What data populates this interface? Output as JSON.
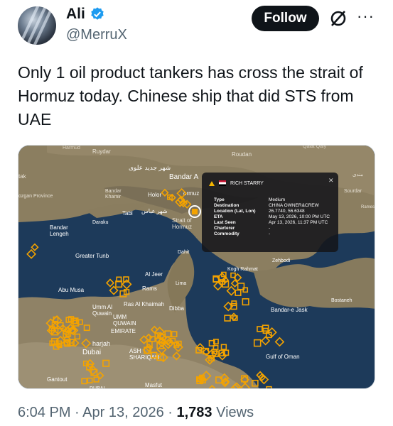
{
  "author": {
    "name": "Ali",
    "handle": "@MerruX",
    "verified": true
  },
  "actions": {
    "follow_label": "Follow",
    "grok_icon": "grok-icon",
    "more_icon": "more-icon",
    "more_glyph": "···"
  },
  "tweet": {
    "text": "Only 1 oil product tankers has cross the strait of Hormuz today. Chinese ship that did STS from UAE"
  },
  "map": {
    "place_labels": {
      "hormud": "Harmud",
      "ruydar": "Ruydar",
      "roudan": "Roudan",
      "qalat": "Qalat Qaly",
      "tak": "tak",
      "shahr_jadid": "شهر جديد علوی",
      "bandar_a": "Bandar A",
      "mandi": "مندی",
      "pezgan": "ozgan Province",
      "bandar_khamir": "Bandar\nKhamir",
      "holor": "Holor",
      "hormuz": "ormuz",
      "sourdar": "Sourdar",
      "rames": "Rames",
      "tabl": "Tabl",
      "shahr_abbas": "شهر عباس",
      "bandar_lengeh": "Bandar\nLengeh",
      "daraku": "Daraku",
      "strait": "Strait of\nHormuz",
      "greater_tunb": "Greater Tunb",
      "dahit": "Dahit",
      "zehbodi": "Zehbodi",
      "kough_rahmat": "Kogh Rahmat",
      "al_jeer": "Al Jeer",
      "abu_musa": "Abu Musa",
      "rams": "Rams",
      "lima": "Lima",
      "ras_al_khaimah": "Ras Al Khaimah",
      "bostaneh": "Bostaneh",
      "umm_al_quwain": "Umm Al\nQuwain",
      "dibba": "Dibba",
      "bandar_e_jask": "Bandar-e Jask",
      "umm_quwain_caps": "UMM\nQUWAIN",
      "emirate": "EMIRATE",
      "sharjah": "harjah",
      "dubai": "Dubai",
      "ash_shariqah": "ASH\nSHARIQAH",
      "gulf_of_oman": "Gulf of Oman",
      "gantout": "Gantout",
      "dubai_caps": "DUBAI",
      "masfut": "Masfut"
    },
    "popup": {
      "ship_name": "RICH STARRY",
      "rows": [
        {
          "label": "Type",
          "value": "Medium"
        },
        {
          "label": "Destination",
          "value": "CHINA OWNER&CREW"
        },
        {
          "label": "Location (Lat, Lon)",
          "value": "26.7740, 56.6348"
        },
        {
          "label": "ETA",
          "value": "May 13, 2026, 10:00 PM UTC"
        },
        {
          "label": "Last Seen",
          "value": "Apr 13, 2026, 11:37 PM UTC"
        },
        {
          "label": "Charterer",
          "value": "-"
        },
        {
          "label": "Commodity",
          "value": "-"
        }
      ]
    },
    "colors": {
      "sea": "#1d3a5a",
      "land": "#8a7d62",
      "marker": "#f4a300"
    }
  },
  "meta": {
    "time": "6:04 PM",
    "date": "Apr 13, 2026",
    "views_count": "1,783",
    "views_label": "Views",
    "sep": "·"
  }
}
